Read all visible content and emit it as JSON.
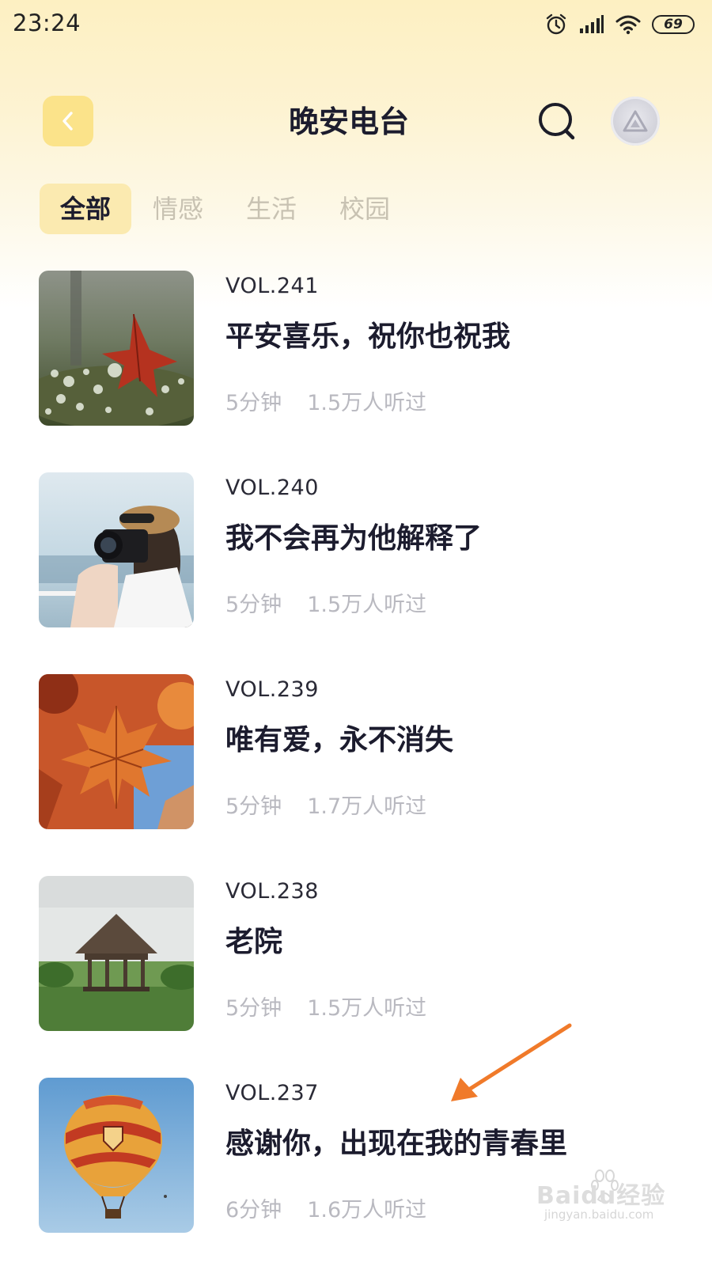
{
  "status_bar": {
    "time": "23:24",
    "battery": "69",
    "icons": [
      "alarm-icon",
      "signal-icon",
      "wifi-icon",
      "battery-icon"
    ]
  },
  "header": {
    "title": "晚安电台",
    "back_icon": "chevron-left-icon",
    "search_icon": "search-icon",
    "avatar_icon": "triangle-logo-icon"
  },
  "tabs": [
    {
      "label": "全部",
      "active": true
    },
    {
      "label": "情感",
      "active": false
    },
    {
      "label": "生活",
      "active": false
    },
    {
      "label": "校园",
      "active": false
    }
  ],
  "episodes": [
    {
      "vol": "VOL.241",
      "title": "平安喜乐，祝你也祝我",
      "duration": "5分钟",
      "listeners": "1.5万人听过",
      "image": "red-leaf-dewdrops"
    },
    {
      "vol": "VOL.240",
      "title": "我不会再为他解释了",
      "duration": "5分钟",
      "listeners": "1.5万人听过",
      "image": "girl-with-camera"
    },
    {
      "vol": "VOL.239",
      "title": "唯有爱，永不消失",
      "duration": "5分钟",
      "listeners": "1.7万人听过",
      "image": "autumn-maple-leaves"
    },
    {
      "vol": "VOL.238",
      "title": "老院",
      "duration": "5分钟",
      "listeners": "1.5万人听过",
      "image": "gazebo-by-lake"
    },
    {
      "vol": "VOL.237",
      "title": "感谢你，出现在我的青春里",
      "duration": "6分钟",
      "listeners": "1.6万人听过",
      "image": "hot-air-balloon"
    }
  ],
  "colors": {
    "accent_yellow": "#fbe38a",
    "tab_active_bg": "#fbeab0",
    "title_text": "#1c1c2e",
    "meta_text": "#b9b9c0",
    "arrow": "#f07a2a"
  },
  "watermark": {
    "brand": "Baidu经验",
    "url": "jingyan.baidu.com"
  }
}
